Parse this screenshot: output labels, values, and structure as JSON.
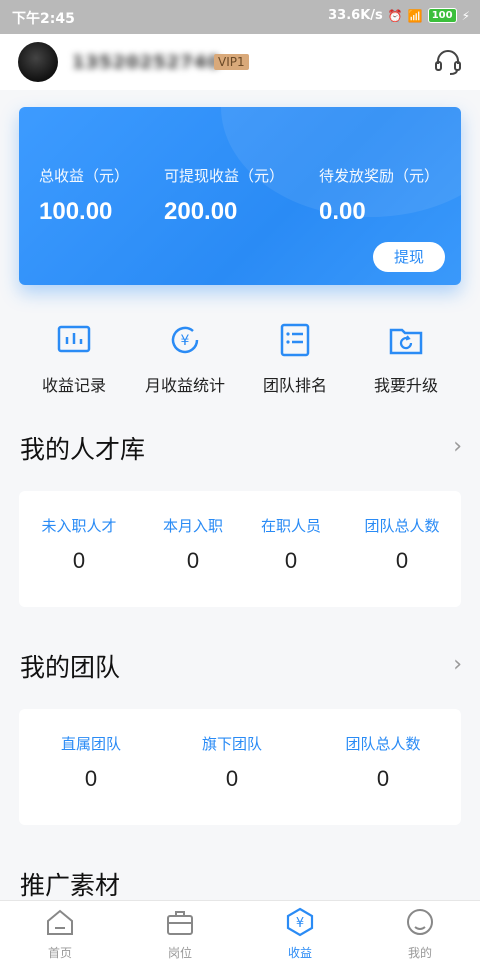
{
  "status_bar": {
    "time": "下午2:45",
    "network_speed": "33.6K/s",
    "battery": "100"
  },
  "profile": {
    "phone": "13520252740",
    "vip": "VIP1"
  },
  "earnings": {
    "total_label": "总收益（元）",
    "total_value": "100.00",
    "withdrawable_label": "可提现收益（元）",
    "withdrawable_value": "200.00",
    "pending_label": "待发放奖励（元）",
    "pending_value": "0.00",
    "withdraw_button": "提现"
  },
  "quick_actions": [
    {
      "label": "收益记录",
      "icon": "chart-icon"
    },
    {
      "label": "月收益统计",
      "icon": "yen-icon"
    },
    {
      "label": "团队排名",
      "icon": "list-icon"
    },
    {
      "label": "我要升级",
      "icon": "folder-upgrade-icon"
    }
  ],
  "talent_pool": {
    "title": "我的人才库",
    "stats": [
      {
        "label": "未入职人才",
        "value": "0"
      },
      {
        "label": "本月入职",
        "value": "0"
      },
      {
        "label": "在职人员",
        "value": "0"
      },
      {
        "label": "团队总人数",
        "value": "0"
      }
    ]
  },
  "my_team": {
    "title": "我的团队",
    "stats": [
      {
        "label": "直属团队",
        "value": "0"
      },
      {
        "label": "旗下团队",
        "value": "0"
      },
      {
        "label": "团队总人数",
        "value": "0"
      }
    ]
  },
  "promo": {
    "title": "推广素材"
  },
  "tabbar": [
    {
      "label": "首页",
      "icon": "home-icon"
    },
    {
      "label": "岗位",
      "icon": "briefcase-icon"
    },
    {
      "label": "收益",
      "icon": "yen-hexagon-icon"
    },
    {
      "label": "我的",
      "icon": "profile-icon"
    }
  ],
  "colors": {
    "accent": "#2a8bf5",
    "card_gradient_start": "#3d9bff",
    "vip_bg": "#d9a97a"
  }
}
